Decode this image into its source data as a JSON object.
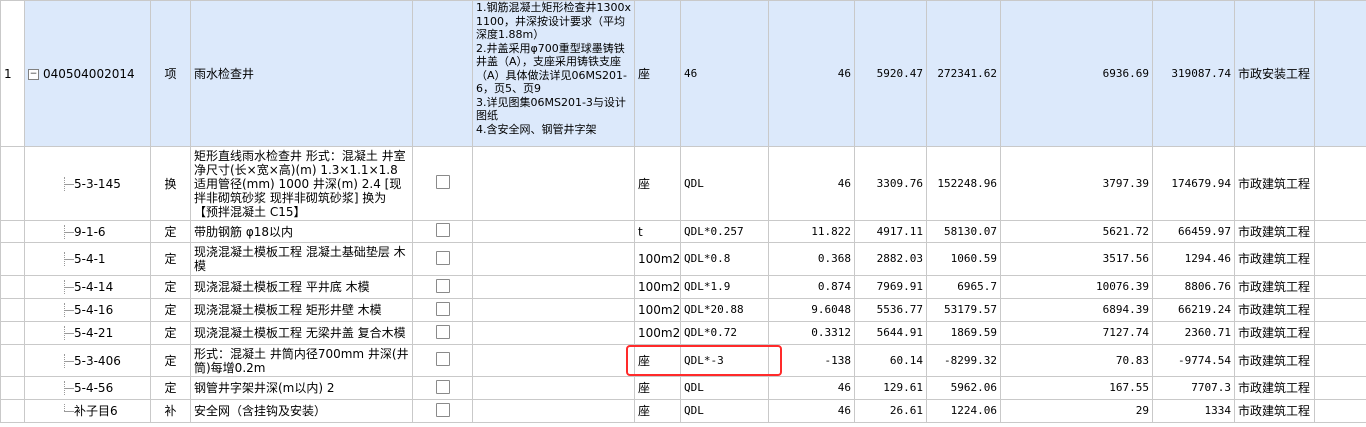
{
  "parent": {
    "index": "1",
    "code": "040504002014",
    "type": "项",
    "name": "雨水检查井",
    "features": "1.钢筋混凝土矩形检查井1300x1100，井深按设计要求（平均深度1.88m）\n2.井盖采用φ700重型球墨铸铁井盖（A），支座采用铸铁支座（A）具体做法详见06MS201-6，页5、页9\n3.详见图集06MS201-3与设计图纸\n4.含安全网、钢管井字架",
    "unit": "座",
    "qty_expr": "46",
    "qty": "46",
    "price": "5920.47",
    "total": "272341.62",
    "unit_cost": "6936.69",
    "total_cost": "319087.74",
    "discipline": "市政安装工程"
  },
  "rows": [
    {
      "code": "5-3-145",
      "type": "换",
      "name": "矩形直线雨水检查井 形式：混凝土 井室净尺寸(长×宽×高)(m) 1.3×1.1×1.8 适用管径(mm) 1000 井深(m) 2.4 [现拌非砌筑砂浆 现拌非砌筑砂浆] 换为【预拌混凝土 C15】",
      "unit": "座",
      "qty_expr": "QDL",
      "qty": "46",
      "price": "3309.76",
      "total": "152248.96",
      "unit_cost": "3797.39",
      "total_cost": "174679.94",
      "discipline": "市政建筑工程"
    },
    {
      "code": "9-1-6",
      "type": "定",
      "name": "带肋钢筋 φ18以内",
      "unit": "t",
      "qty_expr": "QDL*0.257",
      "qty": "11.822",
      "price": "4917.11",
      "total": "58130.07",
      "unit_cost": "5621.72",
      "total_cost": "66459.97",
      "discipline": "市政建筑工程"
    },
    {
      "code": "5-4-1",
      "type": "定",
      "name": "现浇混凝土模板工程 混凝土基础垫层 木模",
      "unit": "100m2",
      "qty_expr": "QDL*0.8",
      "qty": "0.368",
      "price": "2882.03",
      "total": "1060.59",
      "unit_cost": "3517.56",
      "total_cost": "1294.46",
      "discipline": "市政建筑工程"
    },
    {
      "code": "5-4-14",
      "type": "定",
      "name": "现浇混凝土模板工程 平井底 木模",
      "unit": "100m2",
      "qty_expr": "QDL*1.9",
      "qty": "0.874",
      "price": "7969.91",
      "total": "6965.7",
      "unit_cost": "10076.39",
      "total_cost": "8806.76",
      "discipline": "市政建筑工程"
    },
    {
      "code": "5-4-16",
      "type": "定",
      "name": "现浇混凝土模板工程 矩形井壁 木模",
      "unit": "100m2",
      "qty_expr": "QDL*20.88",
      "qty": "9.6048",
      "price": "5536.77",
      "total": "53179.57",
      "unit_cost": "6894.39",
      "total_cost": "66219.24",
      "discipline": "市政建筑工程"
    },
    {
      "code": "5-4-21",
      "type": "定",
      "name": "现浇混凝土模板工程 无梁井盖 复合木模",
      "unit": "100m2",
      "qty_expr": "QDL*0.72",
      "qty": "0.3312",
      "price": "5644.91",
      "total": "1869.59",
      "unit_cost": "7127.74",
      "total_cost": "2360.71",
      "discipline": "市政建筑工程"
    },
    {
      "code": "5-3-406",
      "type": "定",
      "name": "形式：混凝土 井筒内径700mm 井深(井筒)每增0.2m",
      "unit": "座",
      "qty_expr": "QDL*-3",
      "qty": "-138",
      "price": "60.14",
      "total": "-8299.32",
      "unit_cost": "70.83",
      "total_cost": "-9774.54",
      "discipline": "市政建筑工程"
    },
    {
      "code": "5-4-56",
      "type": "定",
      "name": "钢管井字架井深(m以内) 2",
      "unit": "座",
      "qty_expr": "QDL",
      "qty": "46",
      "price": "129.61",
      "total": "5962.06",
      "unit_cost": "167.55",
      "total_cost": "7707.3",
      "discipline": "市政建筑工程"
    },
    {
      "code": "补子目6",
      "type": "补",
      "name": "安全网（含挂钩及安装）",
      "unit": "座",
      "qty_expr": "QDL",
      "qty": "46",
      "price": "26.61",
      "total": "1224.06",
      "unit_cost": "29",
      "total_cost": "1334",
      "discipline": "市政建筑工程"
    }
  ],
  "colors": {
    "parent_bg": "#dce9fb",
    "grid_line": "#c9c9c9",
    "highlight": "#ff2a2a"
  }
}
